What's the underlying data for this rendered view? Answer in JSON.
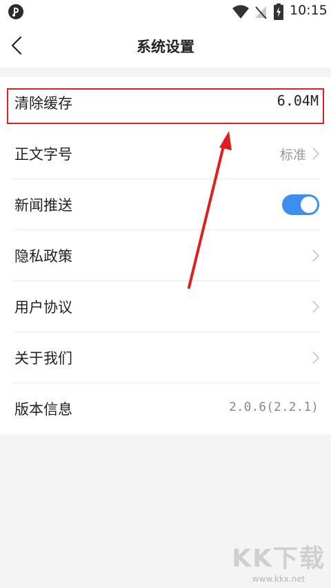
{
  "status_bar": {
    "time": "10:15",
    "icons": [
      "app-notification-icon",
      "wifi-icon",
      "no-signal-icon",
      "battery-charging-icon"
    ]
  },
  "header": {
    "title": "系统设置",
    "back_icon": "chevron-left-icon"
  },
  "settings": {
    "clear_cache": {
      "label": "清除缓存",
      "value": "6.04M"
    },
    "font_size": {
      "label": "正文字号",
      "value": "标准"
    },
    "news_push": {
      "label": "新闻推送",
      "enabled": true
    },
    "privacy_policy": {
      "label": "隐私政策"
    },
    "user_agreement": {
      "label": "用户协议"
    },
    "about_us": {
      "label": "关于我们"
    },
    "version_info": {
      "label": "版本信息",
      "value": "2.0.6(2.2.1)"
    }
  },
  "colors": {
    "toggle_on": "#3d8ef0",
    "highlight": "#e11d1d"
  },
  "watermark": {
    "brand": "KK下载",
    "url": "www.kkx.net"
  }
}
